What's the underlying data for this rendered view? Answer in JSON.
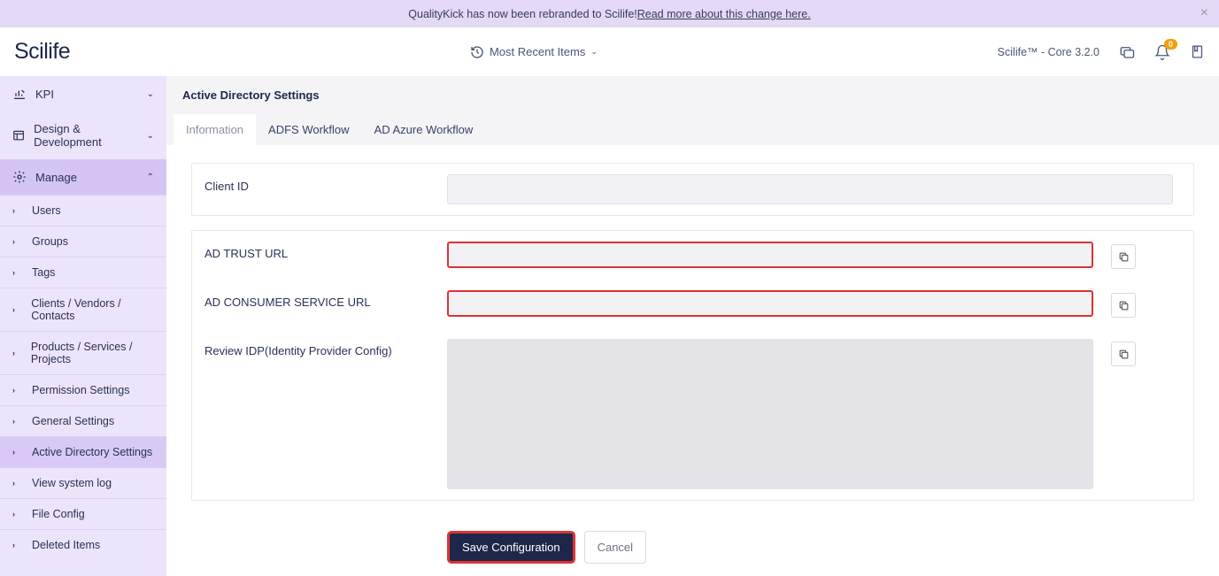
{
  "banner": {
    "text_prefix": "QualityKick has now been rebranded to Scilife! ",
    "link_text": "Read more about this change here."
  },
  "header": {
    "logo": "Scilife",
    "recent_items": "Most Recent Items",
    "version": "Scilife™ - Core 3.2.0",
    "notification_count": "0"
  },
  "sidebar": {
    "kpi": "KPI",
    "design_dev": "Design & Development",
    "manage": "Manage",
    "items": [
      "Users",
      "Groups",
      "Tags",
      "Clients / Vendors / Contacts",
      "Products / Services / Projects",
      "Permission Settings",
      "General Settings",
      "Active Directory Settings",
      "View system log",
      "File Config",
      "Deleted Items"
    ]
  },
  "page": {
    "title": "Active Directory Settings",
    "tabs": [
      "Information",
      "ADFS Workflow",
      "AD Azure Workflow"
    ],
    "form": {
      "client_id_label": "Client ID",
      "ad_trust_label": "AD TRUST URL",
      "ad_consumer_label": "AD CONSUMER SERVICE URL",
      "review_idp_label": "Review IDP(Identity Provider Config)",
      "client_id_value": "",
      "ad_trust_value": "",
      "ad_consumer_value": "",
      "review_idp_value": ""
    },
    "actions": {
      "save": "Save Configuration",
      "cancel": "Cancel"
    }
  }
}
